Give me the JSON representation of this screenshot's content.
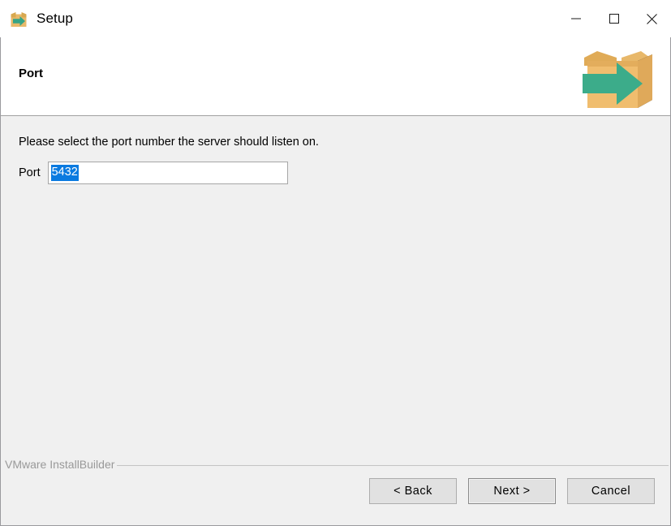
{
  "window": {
    "title": "Setup",
    "icon": "installer-box-icon",
    "controls": [
      {
        "name": "minimize-button",
        "glyph": "minimize-icon",
        "label": "Minimize"
      },
      {
        "name": "maximize-button",
        "glyph": "maximize-icon",
        "label": "Maximize"
      },
      {
        "name": "close-button",
        "glyph": "close-icon",
        "label": "Close"
      }
    ]
  },
  "header": {
    "title": "Port",
    "artwork": "open-box-with-green-arrow-icon"
  },
  "main": {
    "instruction": "Please select the port number the server should listen on.",
    "port_label": "Port",
    "port_value": "5432",
    "port_placeholder": "",
    "port_selected": true
  },
  "footer": {
    "branding": "VMware InstallBuilder",
    "buttons": [
      {
        "name": "back-button",
        "label": "< Back",
        "default": false
      },
      {
        "name": "next-button",
        "label": "Next >",
        "default": true
      },
      {
        "name": "cancel-button",
        "label": "Cancel",
        "default": false
      }
    ]
  },
  "colors": {
    "body_background": "#f0f0f0",
    "header_background": "#ffffff",
    "selection_blue": "#0a7ae0",
    "box_tan": "#eeb964",
    "arrow_green": "#3cac8a",
    "branding_gray": "#999999"
  }
}
